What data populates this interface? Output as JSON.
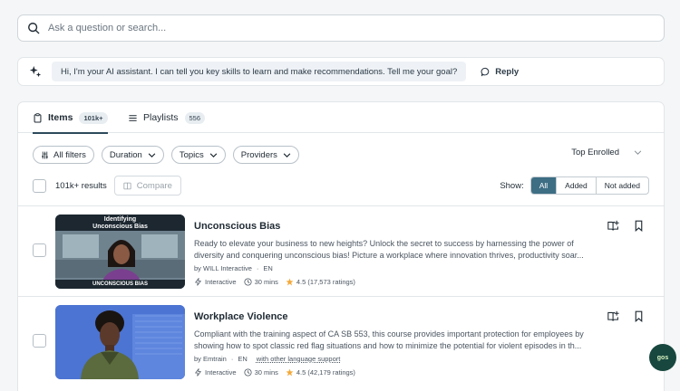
{
  "search": {
    "placeholder": "Ask a question or search..."
  },
  "ai": {
    "message": "Hi, I'm your AI assistant. I can tell you key skills to learn and make recommendations. Tell me your goal?",
    "reply_label": "Reply"
  },
  "tabs": [
    {
      "label": "Items",
      "count": "101k+",
      "active": true
    },
    {
      "label": "Playlists",
      "count": "556",
      "active": false
    }
  ],
  "filters": {
    "all": "All filters",
    "duration": "Duration",
    "topics": "Topics",
    "providers": "Providers"
  },
  "sort": {
    "label": "Top Enrolled"
  },
  "results": {
    "count": "101k+ results",
    "compare": "Compare"
  },
  "show": {
    "label": "Show:",
    "options": [
      "All",
      "Added",
      "Not added"
    ],
    "selected": "All"
  },
  "items": [
    {
      "thumb_title": "Identifying Unconscious Bias",
      "thumb_title_line1": "Identifying",
      "thumb_title_line2": "Unconscious Bias",
      "thumb_caption": "UNCONSCIOUS BIAS",
      "title": "Unconscious Bias",
      "description": "Ready to elevate your business to new heights? Unlock the secret to success by harnessing the power of diversity and conquering unconscious bias! Picture a workplace where innovation thrives, productivity soar...",
      "provider": "by WILL Interactive",
      "language": "EN",
      "type": "Interactive",
      "duration": "30 mins",
      "rating": "4.5 (17,573 ratings)"
    },
    {
      "title": "Workplace Violence",
      "description": "Compliant with the training aspect of CA SB 553, this course provides important protection for employees by showing how to spot classic red flag situations and how to minimize the potential for violent episodes in th...",
      "provider": "by Emtrain",
      "language": "EN",
      "language_link": "with other language support",
      "type": "Interactive",
      "duration": "30 mins",
      "rating": "4.5 (42,179 ratings)"
    }
  ],
  "fab": {
    "label": "gos"
  },
  "colors": {
    "accent": "#3d6e84",
    "fab": "#17473f",
    "star": "#f2a93b"
  }
}
